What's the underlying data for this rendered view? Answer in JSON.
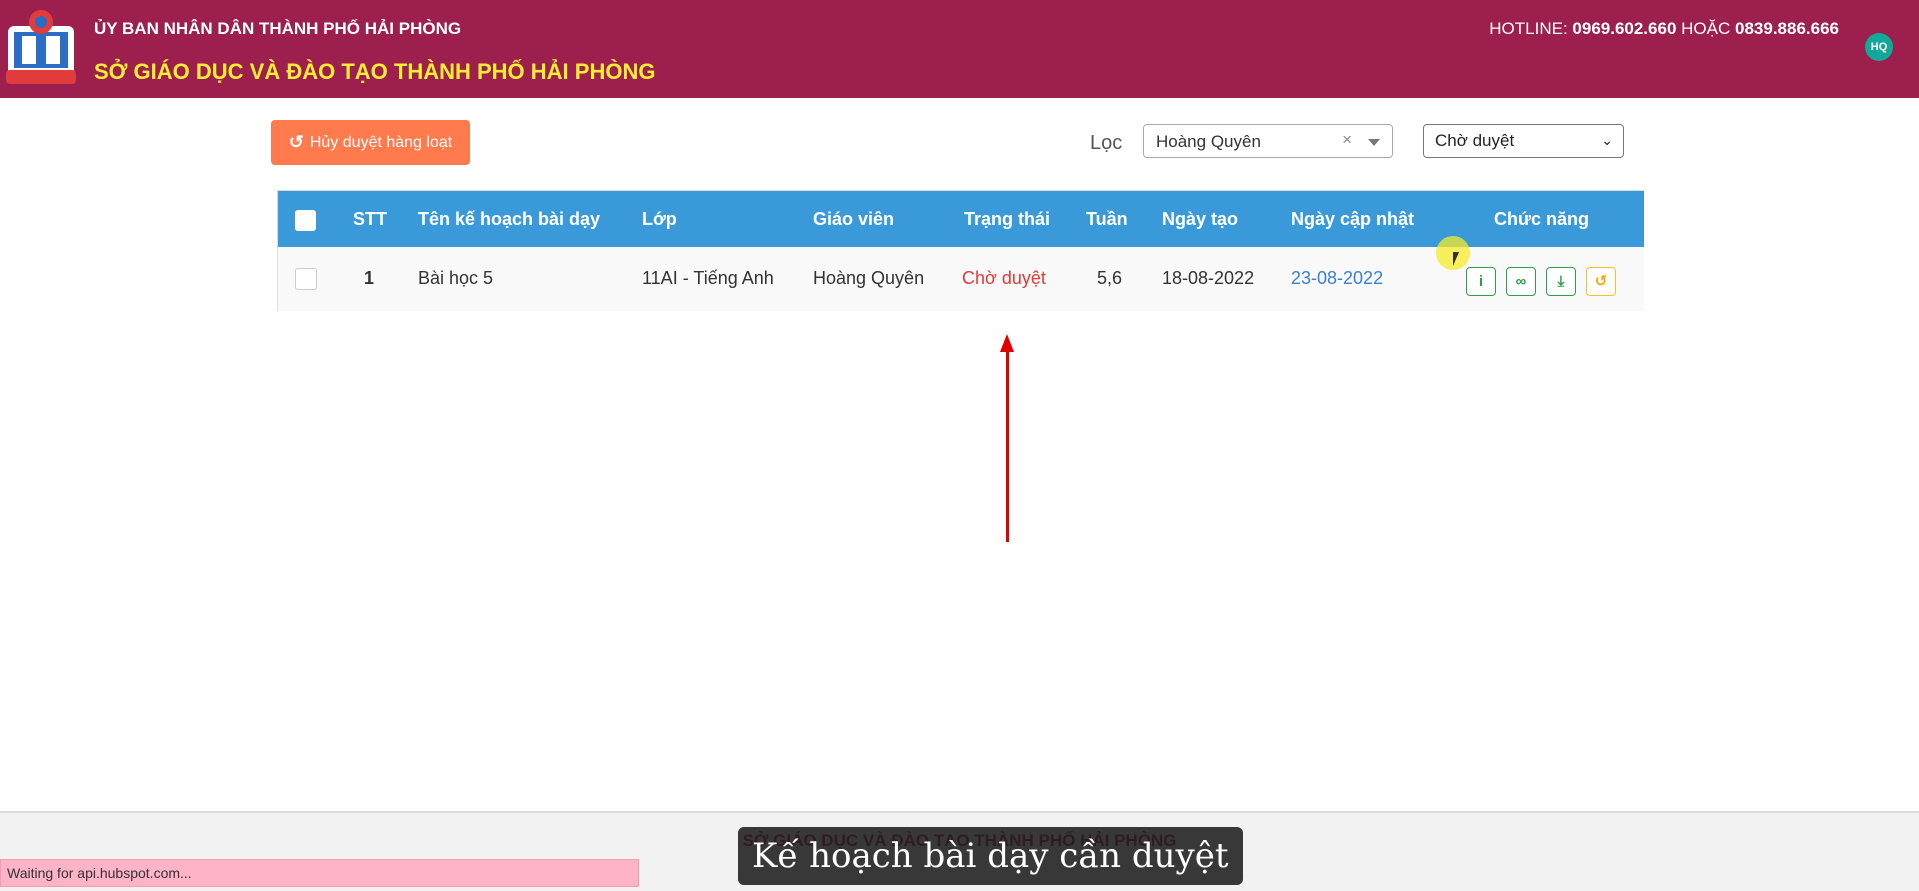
{
  "header": {
    "line1": "ỦY BAN NHÂN DÂN THÀNH PHỐ HẢI PHÒNG",
    "line2": "SỞ GIÁO DỤC VÀ ĐÀO TẠO THÀNH PHỐ HẢI PHÒNG",
    "hotline_label": "HOTLINE:",
    "hotline_1": "0969.602.660",
    "hotline_or": "HOẶC",
    "hotline_2": "0839.886.666",
    "avatar_initials": "HQ",
    "bg_color": "#9c1f4d",
    "title_color": "#ffee33"
  },
  "toolbar": {
    "bulk_cancel_label": "Hủy duyệt hàng loạt",
    "bulk_cancel_icon": "undo-icon",
    "filter_label": "Lọc",
    "teacher_value": "Hoàng Quyên",
    "status_value": "Chờ duyệt"
  },
  "table": {
    "header_color": "#3a9ad9",
    "columns": [
      "STT",
      "Tên kế hoạch bài dạy",
      "Lớp",
      "Giáo viên",
      "Trạng thái",
      "Tuần",
      "Ngày tạo",
      "Ngày cập nhật",
      "Chức năng"
    ],
    "rows": [
      {
        "stt": "1",
        "name": "Bài học 5",
        "class": "11AI - Tiếng Anh",
        "teacher": "Hoàng Quyên",
        "status": "Chờ duyệt",
        "week": "5,6",
        "created": "18-08-2022",
        "updated": "23-08-2022",
        "actions": [
          "info-icon",
          "link-icon",
          "download-icon",
          "history-icon"
        ]
      }
    ]
  },
  "footer": {
    "title": "SỞ GIÁO DỤC VÀ ĐÀO TẠO THÀNH PHỐ HẢI PHÒNG"
  },
  "browser_status": "Waiting for api.hubspot.com...",
  "video_subtitle": "Kế hoạch bài dạy cần duyệt"
}
